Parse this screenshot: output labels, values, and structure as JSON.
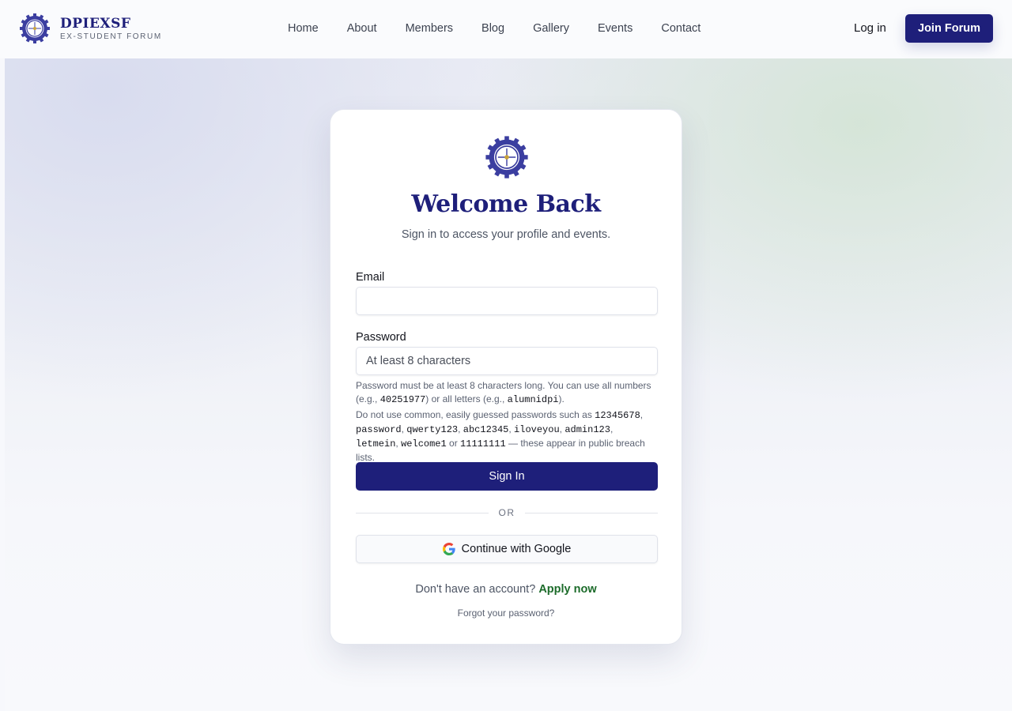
{
  "brand": {
    "name": "DPIEXSF",
    "subtitle": "EX-STUDENT FORUM"
  },
  "nav": {
    "items": [
      "Home",
      "About",
      "Members",
      "Blog",
      "Gallery",
      "Events",
      "Contact"
    ],
    "login_label": "Log in",
    "join_label": "Join Forum"
  },
  "card": {
    "title": "Welcome Back",
    "subtitle": "Sign in to access your profile and events.",
    "email": {
      "label": "Email",
      "value": "",
      "placeholder": ""
    },
    "password": {
      "label": "Password",
      "value": "",
      "placeholder": "At least 8 characters"
    },
    "help1": {
      "t1": "Password must be at least 8 characters long. You can use all numbers (e.g., ",
      "c1": "40251977",
      "t2": ") or all letters (e.g., ",
      "c2": "alumnidpi",
      "t3": ")."
    },
    "help2": {
      "t1": "Do not use common, easily guessed passwords such as ",
      "examples": [
        "12345678",
        "password",
        "qwerty123",
        "abc12345",
        "iloveyou",
        "admin123",
        "letmein",
        "welcome1",
        "11111111"
      ],
      "sep": ", ",
      "or": " or ",
      "t2": " — these appear in public breach lists."
    },
    "signin_label": "Sign In",
    "divider_label": "OR",
    "google_label": "Continue with Google",
    "signup_prompt": "Don't have an account?",
    "signup_link": "Apply now",
    "forgot_label": "Forgot your password?"
  },
  "colors": {
    "primary": "#1e1f7a",
    "accent_green": "#1c6b2a"
  },
  "icons": {
    "brand_logo": "forum-emblem-icon",
    "google": "google-icon"
  }
}
